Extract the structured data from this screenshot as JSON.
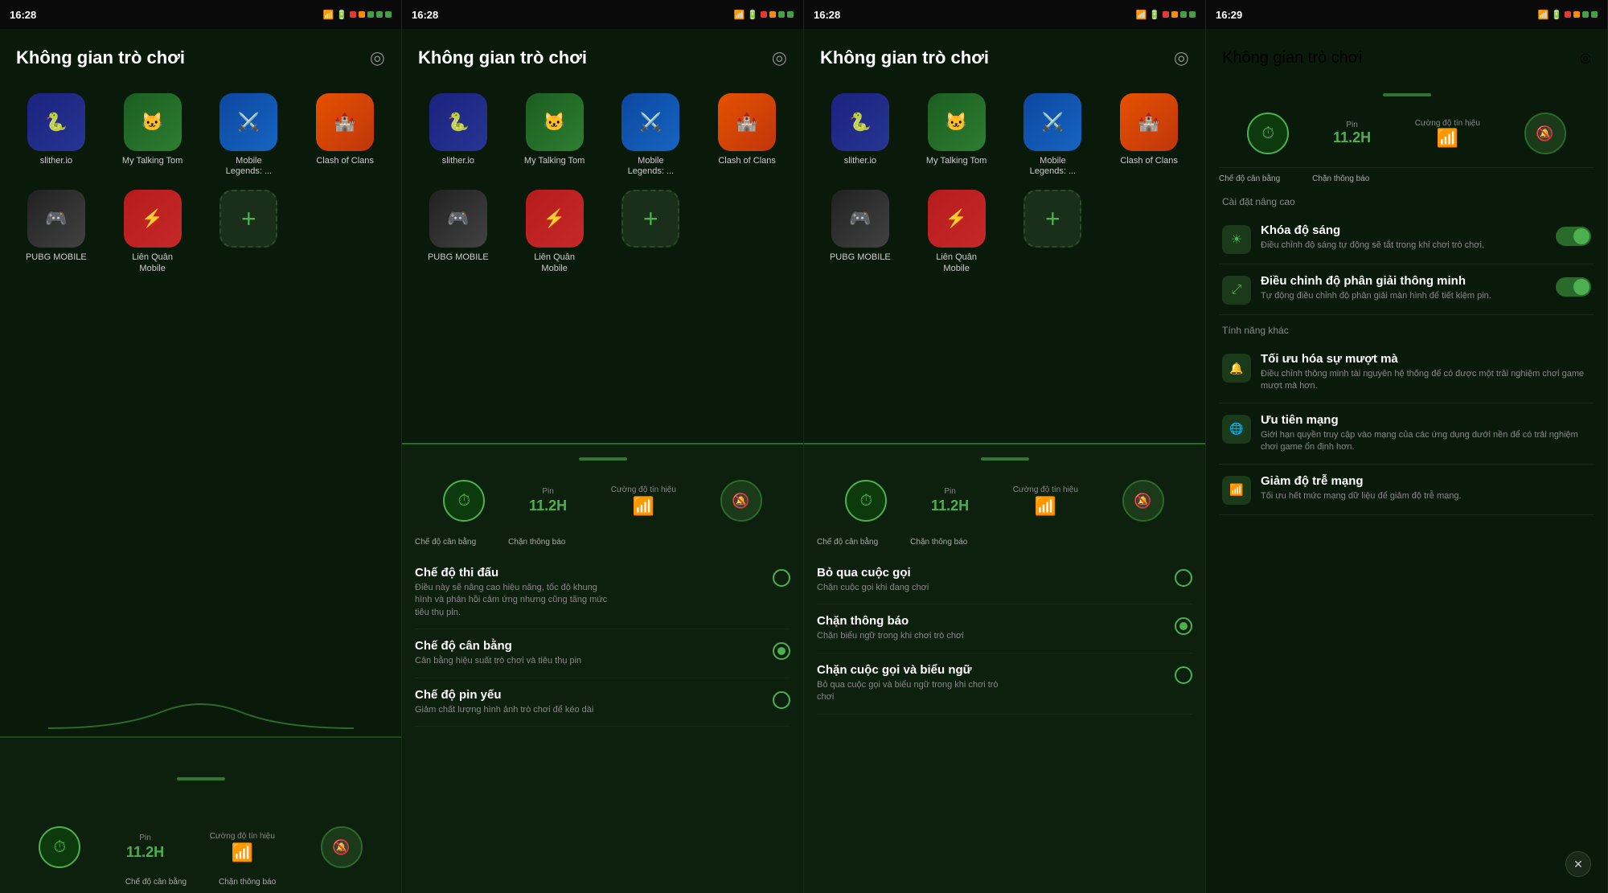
{
  "panels": [
    {
      "id": "panel1",
      "status_time": "16:28",
      "title": "Không gian trò chơi",
      "games_row1": [
        {
          "name": "slither.io",
          "icon_class": "icon-slither",
          "emoji": "🐍"
        },
        {
          "name": "My Talking Tom",
          "icon_class": "icon-tom",
          "emoji": "🐱"
        },
        {
          "name": "Mobile Legends: ...",
          "icon_class": "icon-mobile",
          "emoji": "⚔️"
        },
        {
          "name": "Clash of Clans",
          "icon_class": "icon-clash",
          "emoji": "🏰"
        }
      ],
      "games_row2": [
        {
          "name": "PUBG MOBILE",
          "icon_class": "icon-pubg",
          "emoji": "🎮"
        },
        {
          "name": "Liên Quân Mobile",
          "icon_class": "icon-lienquan",
          "emoji": "⚡"
        }
      ],
      "battery_label": "Pin",
      "battery_value": "11.2H",
      "signal_label": "Cường độ tín hiệu",
      "mode_label": "Chế độ cân bằng",
      "block_label": "Chặn thông báo"
    },
    {
      "id": "panel2",
      "status_time": "16:28",
      "title": "Không gian trò chơi",
      "battery_label": "Pin",
      "battery_value": "11.2H",
      "signal_label": "Cường độ tín hiệu",
      "mode_label": "Chế độ cân bằng",
      "block_label": "Chặn thông báo",
      "settings": [
        {
          "title": "Chế độ thi đấu",
          "desc": "Điều này sẽ nâng cao hiệu năng, tốc độ khung hình và phản hồi cảm ứng nhưng cũng tăng mức tiêu thụ pin.",
          "type": "radio",
          "selected": false
        },
        {
          "title": "Chế độ cân bằng",
          "desc": "Cân bằng hiệu suất trò chơi và tiêu thụ pin",
          "type": "radio",
          "selected": true
        },
        {
          "title": "Chế độ pin yếu",
          "desc": "Giảm chất lượng hình ảnh trò chơi để kéo dài",
          "type": "radio",
          "selected": false
        }
      ]
    },
    {
      "id": "panel3",
      "status_time": "16:28",
      "title": "Không gian trò chơi",
      "battery_label": "Pin",
      "battery_value": "11.2H",
      "signal_label": "Cường độ tín hiệu",
      "mode_label": "Chế độ cân bằng",
      "block_label": "Chặn thông báo",
      "settings": [
        {
          "title": "Bỏ qua cuộc gọi",
          "desc": "Chặn cuộc gọi khi đang chơi",
          "type": "radio",
          "selected": false
        },
        {
          "title": "Chặn thông báo",
          "desc": "Chặn biểu ngữ trong khi chơi trò chơi",
          "type": "radio",
          "selected": true
        },
        {
          "title": "Chặn cuộc gọi và biểu ngữ",
          "desc": "Bỏ qua cuộc gọi và biểu ngữ trong khi chơi trò chơi",
          "type": "radio",
          "selected": false
        }
      ]
    },
    {
      "id": "panel4",
      "status_time": "16:29",
      "title": "Không gian trò chơi",
      "battery_label": "Pin",
      "battery_value": "11.2H",
      "signal_label": "Cường độ tín hiệu",
      "mode_label": "Chế độ cân bằng",
      "block_label": "Chặn thông báo",
      "advanced_label": "Cài đặt nâng cao",
      "other_label": "Tính năng khác",
      "advanced_settings": [
        {
          "title": "Khóa độ sáng",
          "desc": "Điều chỉnh độ sáng tự động sẽ tắt trong khi chơi trò chơi.",
          "icon": "☀",
          "toggle": true
        },
        {
          "title": "Điều chỉnh độ phân giải thông minh",
          "desc": "Tự động điều chỉnh độ phân giải màn hình để tiết kiệm pin.",
          "icon": "⤢",
          "toggle": true
        }
      ],
      "other_settings": [
        {
          "title": "Tối ưu hóa sự mượt mà",
          "desc": "Điều chỉnh thông minh tài nguyên hệ thống để có được một trải nghiệm chơi game mượt mà hơn.",
          "icon": "🔔"
        },
        {
          "title": "Ưu tiên mạng",
          "desc": "Giới hạn quyền truy cập vào mạng của các ứng dụng dưới nền để có trải nghiệm chơi game ổn định hơn.",
          "icon": "🌐"
        },
        {
          "title": "Giảm độ trễ mạng",
          "desc": "Tối ưu hết mức mạng dữ liệu để giảm độ trễ mạng.",
          "icon": "📶"
        }
      ],
      "close_label": "✕"
    }
  ]
}
